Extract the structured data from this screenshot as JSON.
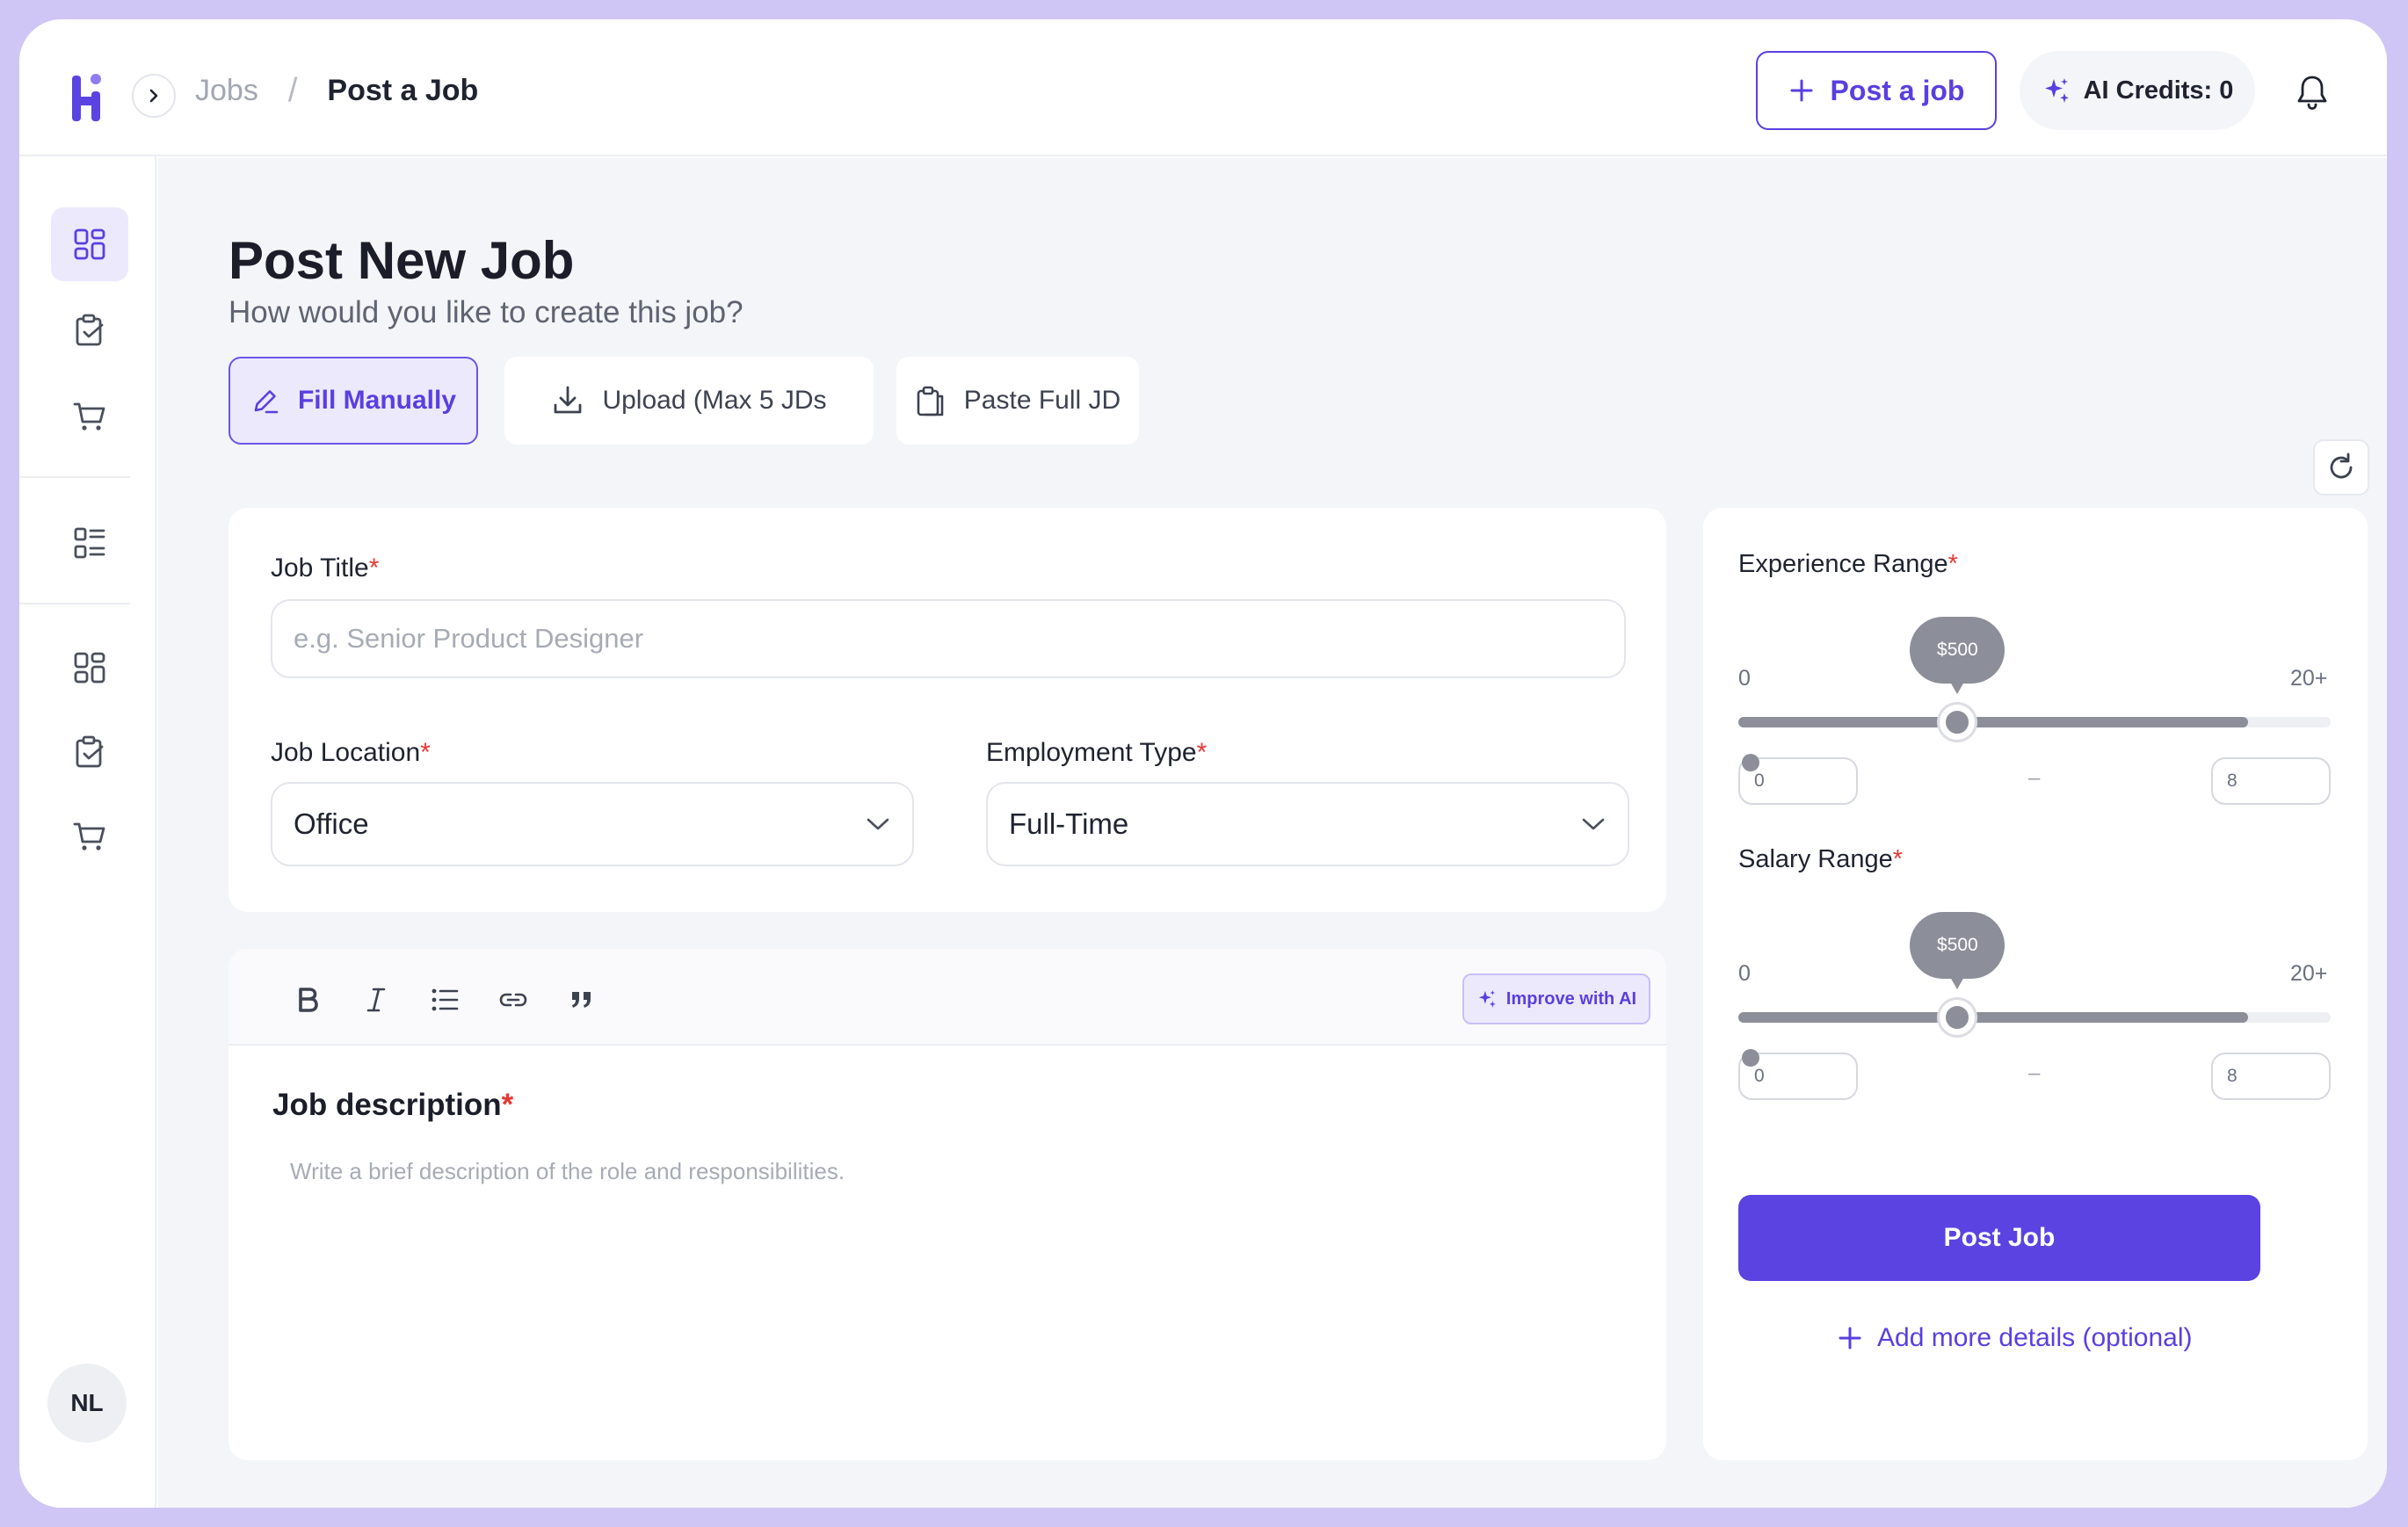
{
  "header": {
    "breadcrumb": {
      "root": "Jobs",
      "separator": "/",
      "current": "Post a Job"
    },
    "post_job_label": "Post a job",
    "credits_label": "AI Credits: 0"
  },
  "sidebar": {
    "items": [
      {
        "icon": "dashboard-icon",
        "active": true
      },
      {
        "icon": "clipboard-check-icon",
        "active": false
      },
      {
        "icon": "cart-icon",
        "active": false
      },
      {
        "icon": "list-icon",
        "active": false
      },
      {
        "icon": "dashboard-icon",
        "active": false
      },
      {
        "icon": "clipboard-check-icon",
        "active": false
      },
      {
        "icon": "cart-icon",
        "active": false
      }
    ],
    "avatar_initials": "NL"
  },
  "page": {
    "title": "Post New Job",
    "subtitle": "How would you like to create this job?"
  },
  "modes": {
    "manual": "Fill Manually",
    "upload": "Upload (Max 5 JDs",
    "paste": "Paste Full JD",
    "active": "manual"
  },
  "form": {
    "job_title": {
      "label": "Job Title",
      "required": "*",
      "placeholder": "e.g. Senior Product Designer",
      "value": ""
    },
    "location": {
      "label": "Job Location",
      "required": "*",
      "value": "Office"
    },
    "employment_type": {
      "label": "Employment Type",
      "required": "*",
      "value": "Full-Time"
    },
    "description": {
      "title": "Job description",
      "required": "*",
      "placeholder": "Write a brief description of the role and responsibilities.",
      "improve_label": "Improve with AI"
    }
  },
  "ranges": {
    "experience": {
      "label": "Experience Range",
      "required": "*",
      "min_tick": "0",
      "max_tick": "20+",
      "bubble": "$500",
      "min_value": "0",
      "max_value": "8",
      "dash": "–",
      "knob_fraction": 0.37,
      "fill_fraction": 0.86
    },
    "salary": {
      "label": "Salary Range",
      "required": "*",
      "min_tick": "0",
      "max_tick": "20+",
      "bubble": "$500",
      "min_value": "0",
      "max_value": "8",
      "dash": "–",
      "knob_fraction": 0.37,
      "fill_fraction": 0.86
    }
  },
  "actions": {
    "post_job": "Post Job",
    "add_more": "Add more details (optional)"
  },
  "colors": {
    "accent": "#5b43e2",
    "accent_light": "#ece9fd",
    "required": "#e53935",
    "slider": "#8c8e99"
  }
}
